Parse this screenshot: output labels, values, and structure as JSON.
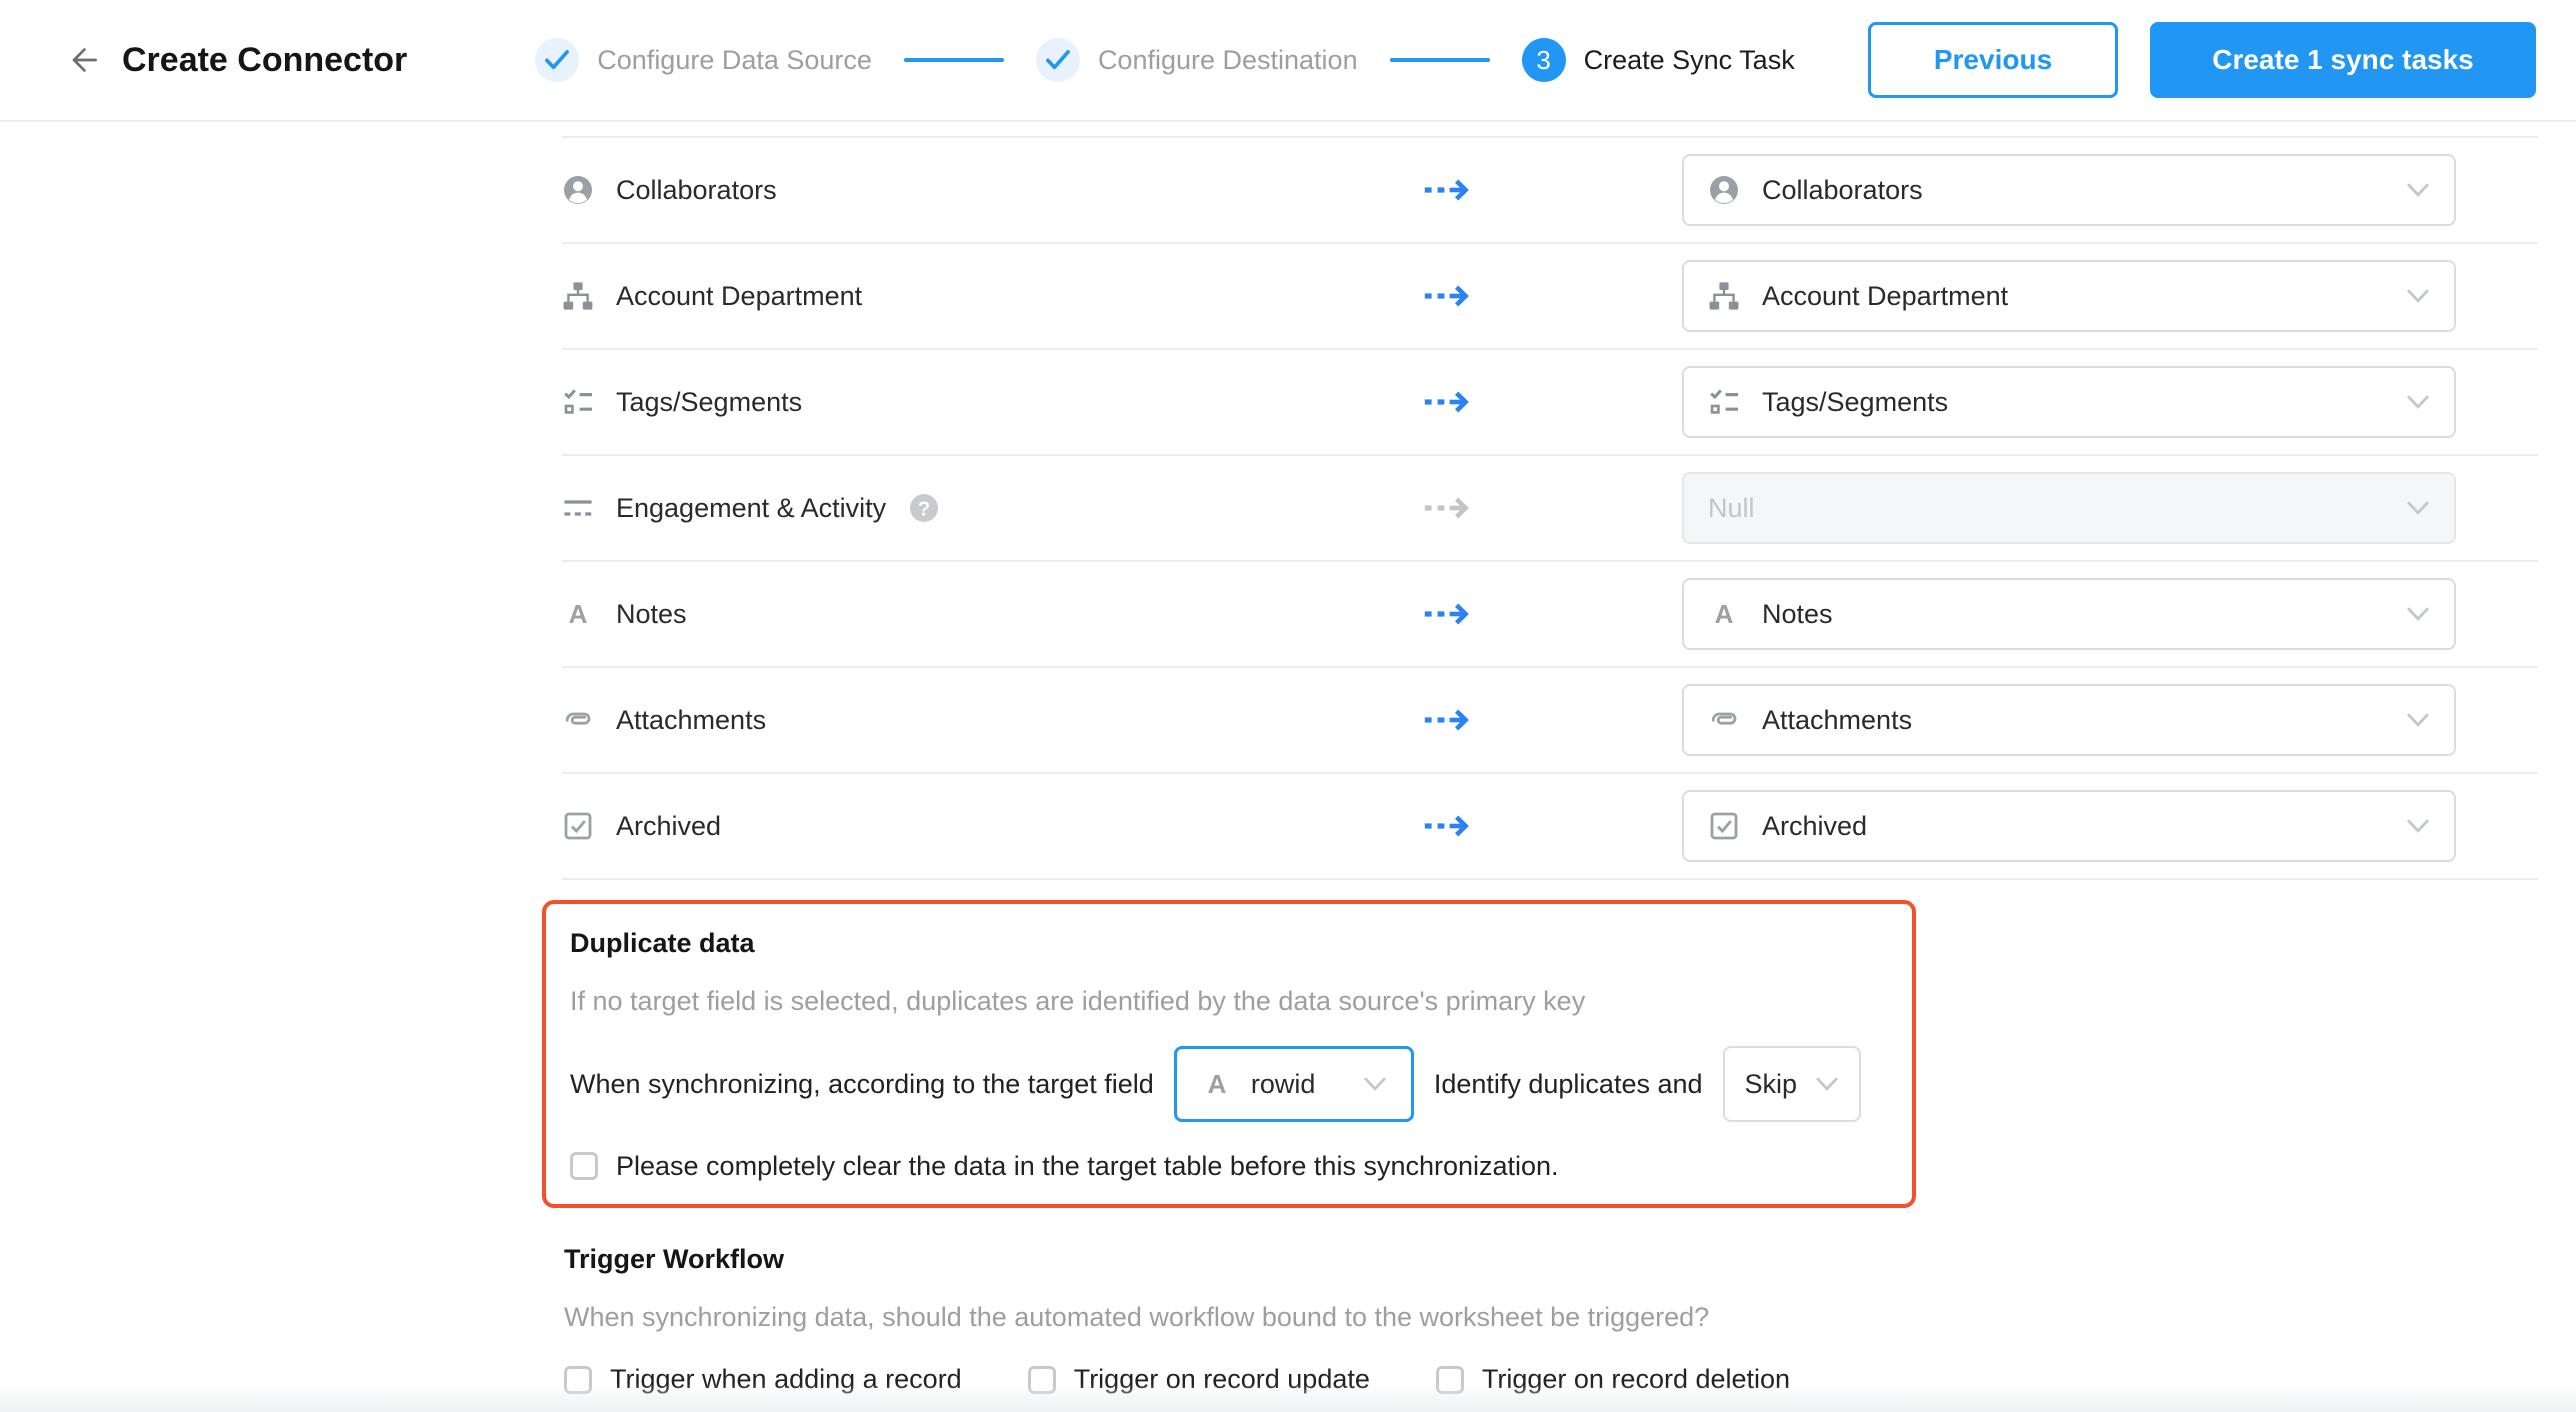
{
  "colors": {
    "accent": "#2196f3",
    "highlight_border": "#f4502c"
  },
  "header": {
    "back_icon": "arrow-left-icon",
    "title": "Create Connector",
    "steps": [
      {
        "label": "Configure Data Source",
        "state": "done",
        "icon": "check-icon"
      },
      {
        "label": "Configure Destination",
        "state": "done",
        "icon": "check-icon"
      },
      {
        "label": "Create Sync Task",
        "state": "active",
        "number": "3"
      }
    ],
    "buttons": {
      "previous": "Previous",
      "create": "Create 1 sync tasks"
    }
  },
  "mapping": {
    "arrow_icon": "dashed-arrow-icon",
    "chevron_icon": "chevron-down-icon",
    "rows": [
      {
        "source": "Collaborators",
        "icon": "user-icon",
        "target": "Collaborators",
        "target_icon": "user-icon",
        "disabled": false
      },
      {
        "source": "Account Department",
        "icon": "org-chart-icon",
        "target": "Account Department",
        "target_icon": "org-chart-icon",
        "disabled": false
      },
      {
        "source": "Tags/Segments",
        "icon": "checklist-icon",
        "target": "Tags/Segments",
        "target_icon": "checklist-icon",
        "disabled": false
      },
      {
        "source": "Engagement & Activity",
        "icon": "dashed-lines-icon",
        "help_icon": "help-icon",
        "target": "Null",
        "target_icon": null,
        "disabled": true
      },
      {
        "source": "Notes",
        "icon": "letter-a-icon",
        "target": "Notes",
        "target_icon": "letter-a-icon",
        "disabled": false
      },
      {
        "source": "Attachments",
        "icon": "paperclip-icon",
        "target": "Attachments",
        "target_icon": "paperclip-icon",
        "disabled": false
      },
      {
        "source": "Archived",
        "icon": "checkbox-check-icon",
        "target": "Archived",
        "target_icon": "checkbox-check-icon",
        "disabled": false
      }
    ]
  },
  "duplicate": {
    "title": "Duplicate data",
    "description": "If no target field is selected, duplicates are identified by the data source's primary key",
    "row": {
      "label_before": "When synchronizing, according to the target field",
      "field_icon": "letter-a-icon",
      "field_value": "rowid",
      "label_between": "Identify duplicates and",
      "action_value": "Skip"
    },
    "clear_checkbox": {
      "checked": false,
      "label": "Please completely clear the data in the target table before this synchronization."
    }
  },
  "workflow": {
    "title": "Trigger Workflow",
    "description": "When synchronizing data, should the automated workflow bound to the worksheet be triggered?",
    "options": [
      {
        "label": "Trigger when adding a record",
        "checked": false
      },
      {
        "label": "Trigger on record update",
        "checked": false
      },
      {
        "label": "Trigger on record deletion",
        "checked": false
      }
    ]
  }
}
